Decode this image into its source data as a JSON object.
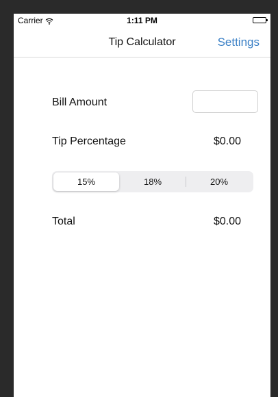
{
  "status_bar": {
    "carrier": "Carrier",
    "time": "1:11 PM",
    "wifi_icon": "wifi-icon",
    "battery_icon": "battery-icon"
  },
  "nav": {
    "title": "Tip Calculator",
    "settings_label": "Settings",
    "accent_color": "#3b80c6"
  },
  "bill": {
    "label": "Bill Amount",
    "value": "",
    "placeholder": ""
  },
  "tip": {
    "label": "Tip Percentage",
    "value": "$0.00"
  },
  "tip_options": {
    "segments": [
      "15%",
      "18%",
      "20%"
    ],
    "selected": "15%"
  },
  "total": {
    "label": "Total",
    "value": "$0.00"
  }
}
